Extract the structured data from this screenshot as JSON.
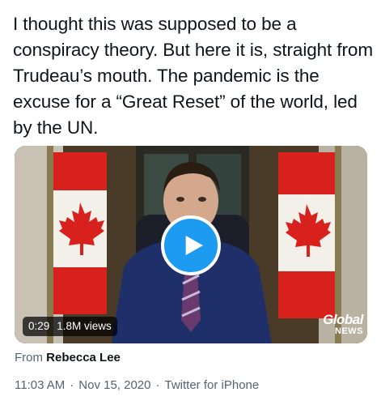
{
  "tweet": {
    "text": "I thought this was supposed to be a conspiracy theory. But here it is, straight from Trudeau’s mouth. The pandemic is the excuse for a “Great Reset” of the world, led by the UN."
  },
  "video": {
    "duration": "0:29",
    "views": "1.8M views",
    "watermark_line1": "Global",
    "watermark_line2": "NEWS",
    "play_icon": "play-icon",
    "accent_color": "#1d9bf0"
  },
  "source": {
    "from_label": "From",
    "author": "Rebecca Lee"
  },
  "meta": {
    "time": "11:03 AM",
    "separator1": "·",
    "date": "Nov 15, 2020",
    "separator2": "·",
    "client": "Twitter for iPhone"
  }
}
